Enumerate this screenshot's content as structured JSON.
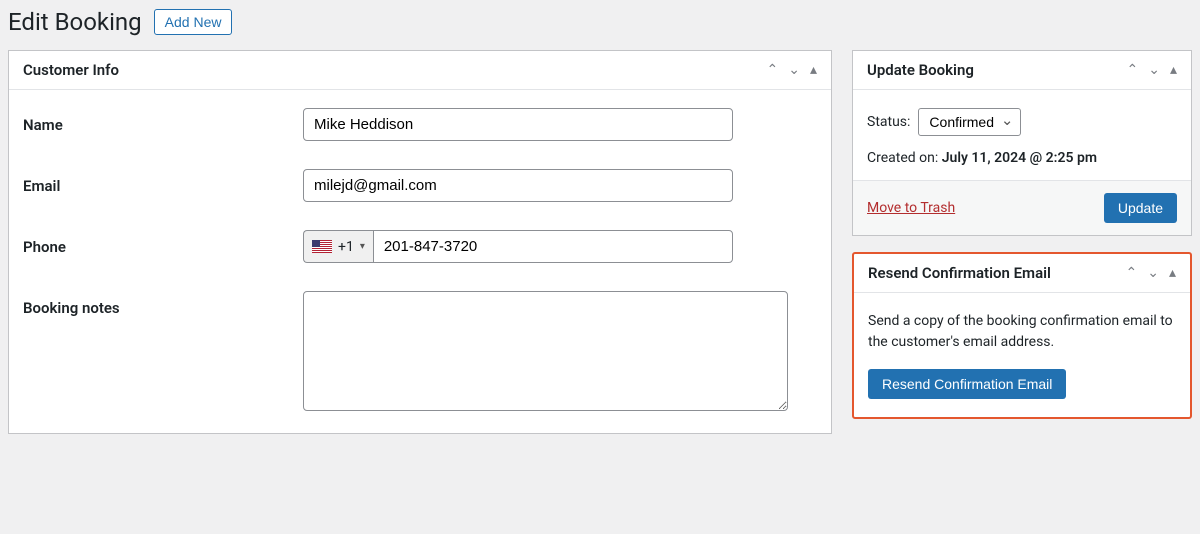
{
  "header": {
    "title": "Edit Booking",
    "add_new_label": "Add New"
  },
  "customer_panel": {
    "title": "Customer Info",
    "fields": {
      "name_label": "Name",
      "name_value": "Mike Heddison",
      "email_label": "Email",
      "email_value": "milejd@gmail.com",
      "phone_label": "Phone",
      "phone_prefix": "+1",
      "phone_value": "201-847-3720",
      "notes_label": "Booking notes",
      "notes_value": ""
    }
  },
  "update_panel": {
    "title": "Update Booking",
    "status_label": "Status:",
    "status_value": "Confirmed",
    "created_label": "Created on: ",
    "created_value": "July 11, 2024 @ 2:25 pm",
    "trash_label": "Move to Trash",
    "update_button": "Update"
  },
  "resend_panel": {
    "title": "Resend Confirmation Email",
    "description": "Send a copy of the booking confirmation email to the customer's email address.",
    "button_label": "Resend Confirmation Email"
  }
}
